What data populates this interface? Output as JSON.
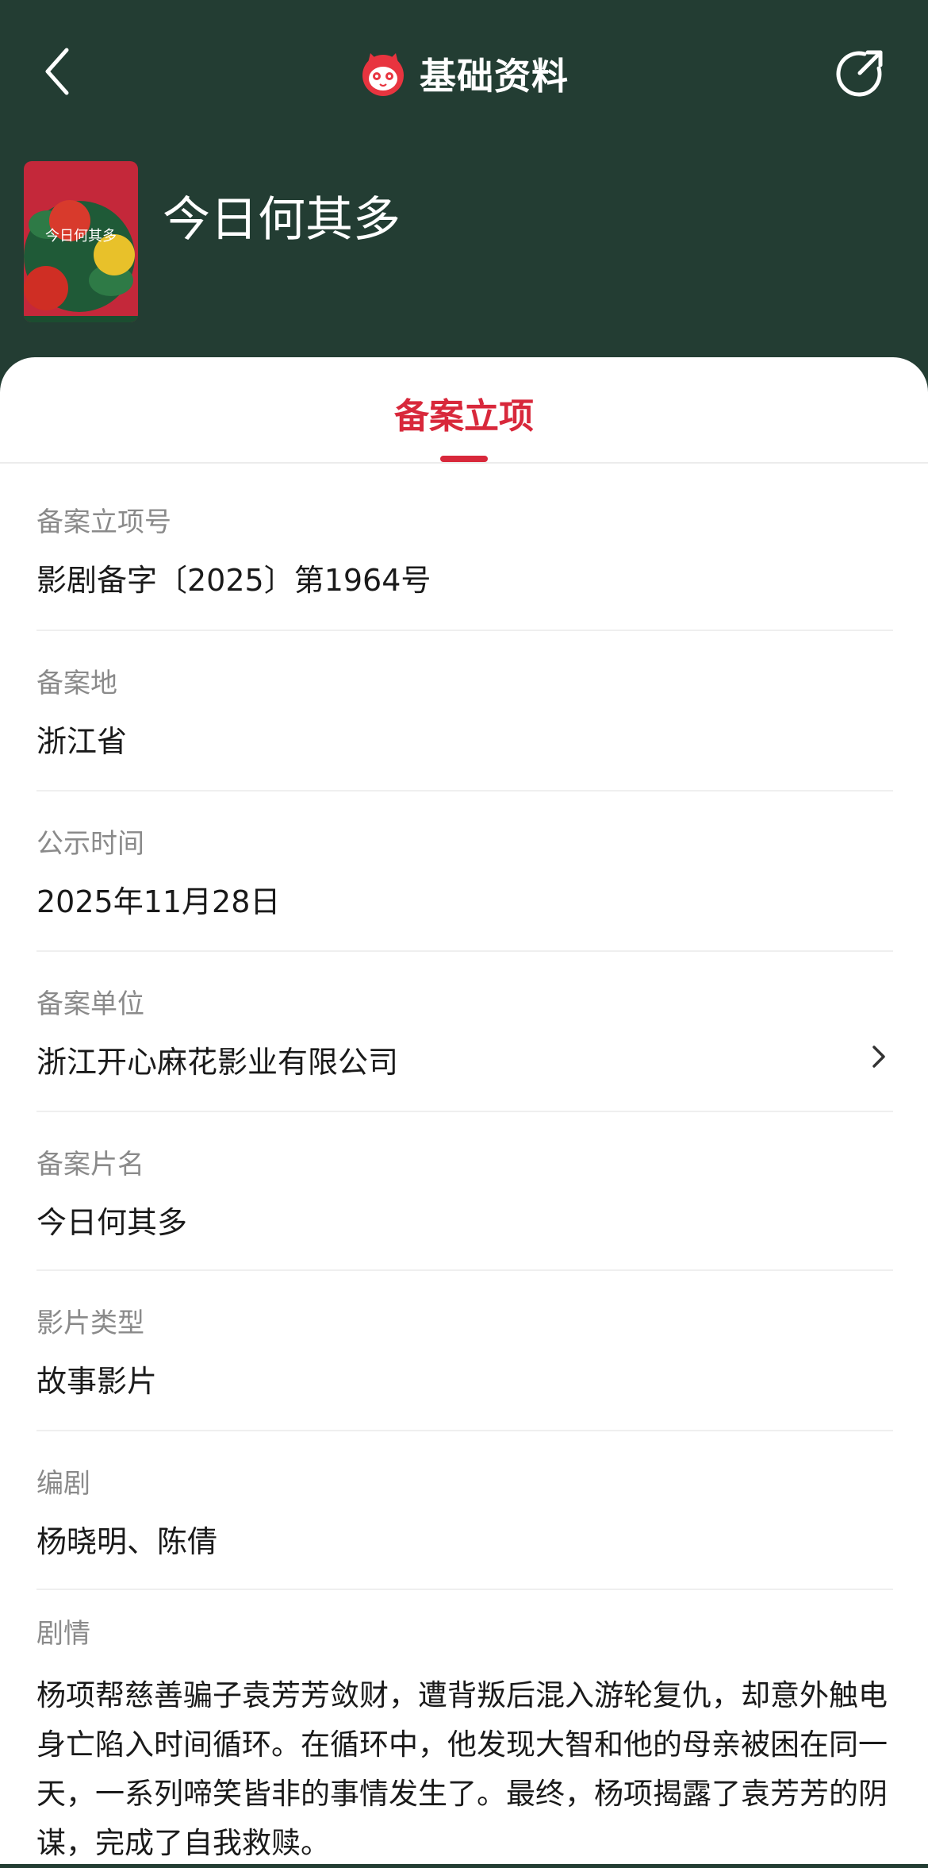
{
  "header": {
    "title": "基础资料"
  },
  "movie": {
    "name": "今日何其多",
    "poster_text": "今日何其多"
  },
  "tabs": [
    {
      "label": "备案立项",
      "active": true
    }
  ],
  "fields": [
    {
      "label": "备案立项号",
      "value": "影剧备字〔2025〕第1964号"
    },
    {
      "label": "备案地",
      "value": "浙江省"
    },
    {
      "label": "公示时间",
      "value": "2025年11月28日"
    },
    {
      "label": "备案单位",
      "value": "浙江开心麻花影业有限公司"
    },
    {
      "label": "备案片名",
      "value": "今日何其多"
    },
    {
      "label": "影片类型",
      "value": "故事影片"
    },
    {
      "label": "编剧",
      "value": "杨晓明、陈倩"
    }
  ],
  "plot": {
    "label": "剧情",
    "text": "杨项帮慈善骗子袁芳芳敛财，遭背叛后混入游轮复仇，却意外触电身亡陷入时间循环。在循环中，他发现大智和他的母亲被困在同一天，一系列啼笑皆非的事情发生了。最终，杨项揭露了袁芳芳的阴谋，完成了自我救赎。"
  },
  "colors": {
    "header_bg": "#233d33",
    "accent": "#d8283b"
  },
  "icons": {
    "back": "chevron-left-icon",
    "logo": "maoyan-cat-logo",
    "share": "share-icon",
    "arrow": "chevron-right-icon"
  }
}
